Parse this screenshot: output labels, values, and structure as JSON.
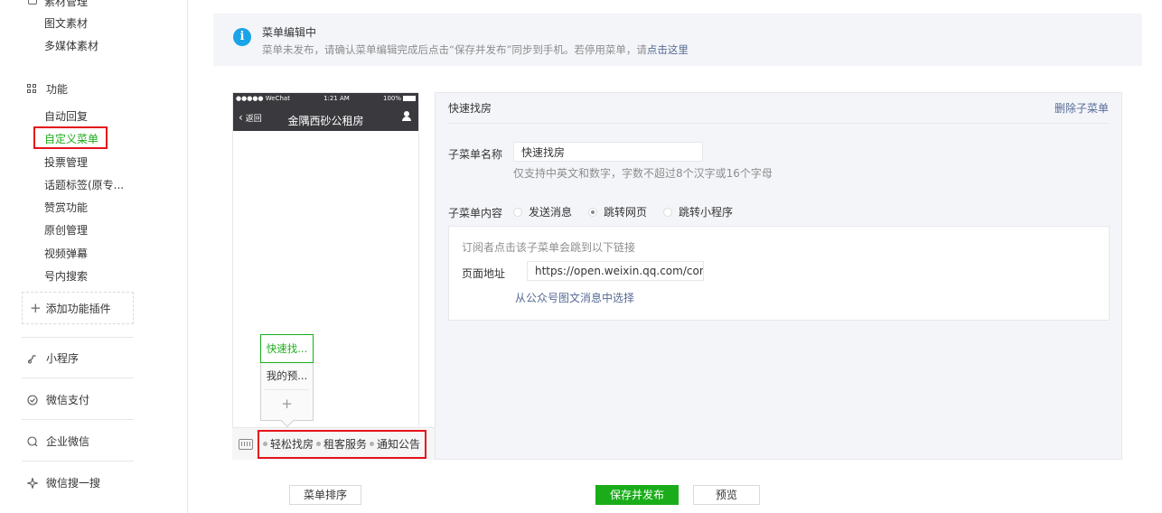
{
  "sidebar": {
    "cut_heading": "素材管理",
    "material_items": [
      "图文素材",
      "多媒体素材"
    ],
    "function_heading": "功能",
    "function_items": [
      "自动回复",
      "自定义菜单",
      "投票管理",
      "话题标签(原专...",
      "赞赏功能",
      "原创管理",
      "视频弹幕",
      "号内搜索"
    ],
    "active_item": "自定义菜单",
    "add_plugin": "添加功能插件",
    "sections": [
      "小程序",
      "微信支付",
      "企业微信",
      "微信搜一搜"
    ]
  },
  "notice": {
    "title": "菜单编辑中",
    "text": "菜单未发布，请确认菜单编辑完成后点击“保存并发布”同步到手机。若停用菜单，请",
    "link": "点击这里"
  },
  "phone": {
    "carrier": "●●●●● WeChat",
    "time": "1:21 AM",
    "battery": "100%",
    "back_label": "返回",
    "title": "金隅西砂公租房",
    "submenu_items": [
      "快速找...",
      "我的预..."
    ],
    "submenu_add": "+",
    "menu_items": [
      "轻松找房",
      "租客服务",
      "通知公告"
    ]
  },
  "editor": {
    "header_title": "快速找房",
    "delete_label": "删除子菜单",
    "name_label": "子菜单名称",
    "name_value": "快速找房",
    "name_hint": "仅支持中英文和数字，字数不超过8个汉字或16个字母",
    "content_label": "子菜单内容",
    "content_options": [
      "发送消息",
      "跳转网页",
      "跳转小程序"
    ],
    "selected_option": "跳转网页",
    "link_hint": "订阅者点击该子菜单会跳到以下链接",
    "url_label": "页面地址",
    "url_value": "https://open.weixin.qq.com/con",
    "pick_from_articles": "从公众号图文消息中选择"
  },
  "buttons": {
    "sort": "菜单排序",
    "save_publish": "保存并发布",
    "preview": "预览"
  },
  "colors": {
    "accent_green": "#1aad19",
    "link_blue": "#576b95",
    "info_blue": "#1aa3e8",
    "highlight_red": "#e4141b"
  }
}
